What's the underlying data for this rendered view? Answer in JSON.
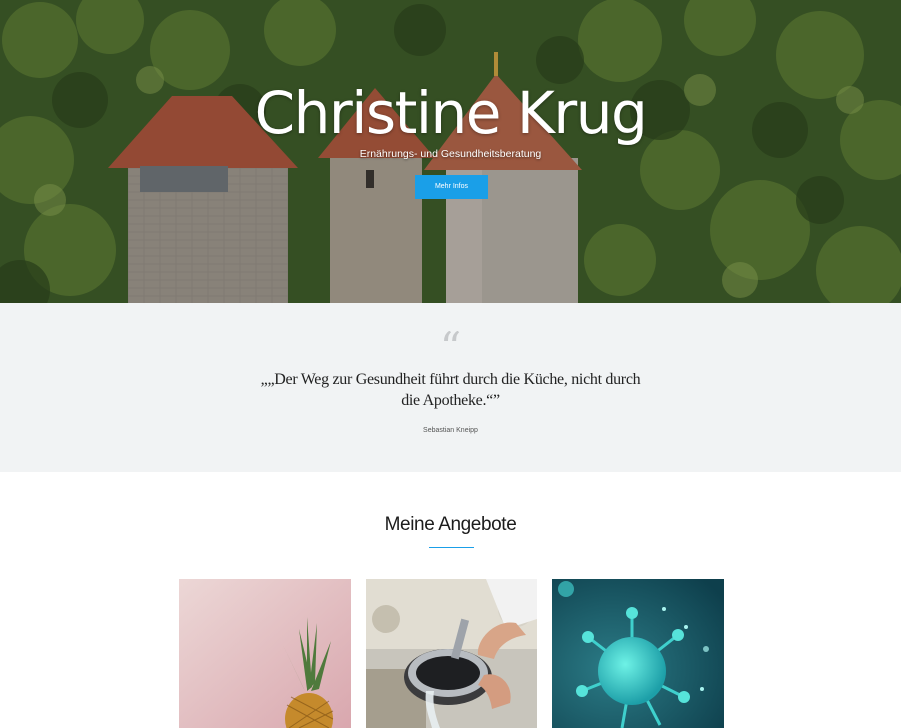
{
  "hero": {
    "title": "Christine Krug",
    "subtitle": "Ernährungs- und Gesundheitsberatung",
    "button_label": "Mehr Infos",
    "button_color": "#1a9fe8"
  },
  "quote": {
    "mark": "“",
    "text": "„„Der Weg zur Gesundheit führt durch die Küche, nicht durch die Apotheke.“”",
    "author": "Sebastian Kneipp"
  },
  "offers": {
    "title": "Meine Angebote",
    "accent_color": "#1a9fe8",
    "cards": [
      {
        "icon": "pineapple-image"
      },
      {
        "icon": "pouring-water-image"
      },
      {
        "icon": "virus-image"
      }
    ]
  }
}
